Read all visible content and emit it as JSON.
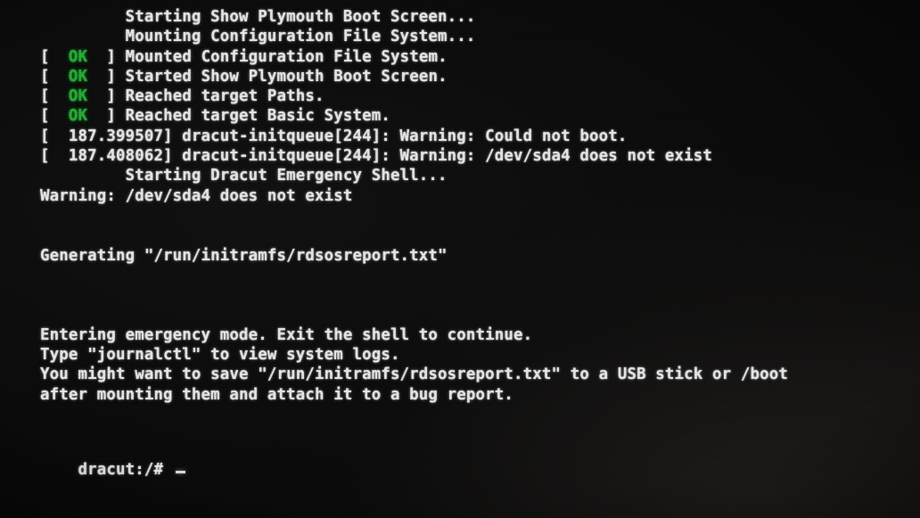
{
  "screen": {
    "kind": "linux-boot-console",
    "background_color": "#050505",
    "text_color": "#e9e9e6",
    "ok_color": "#25ad33"
  },
  "console": {
    "lines": [
      {
        "segments": [
          {
            "text": "         Starting Show Plymouth Boot Screen...",
            "style": "normal"
          }
        ]
      },
      {
        "segments": [
          {
            "text": "         Mounting Configuration File System...",
            "style": "normal"
          }
        ]
      },
      {
        "segments": [
          {
            "text": "[  ",
            "style": "normal"
          },
          {
            "text": "OK",
            "style": "ok"
          },
          {
            "text": "  ] Mounted Configuration File System.",
            "style": "normal"
          }
        ]
      },
      {
        "segments": [
          {
            "text": "[  ",
            "style": "normal"
          },
          {
            "text": "OK",
            "style": "ok"
          },
          {
            "text": "  ] Started Show Plymouth Boot Screen.",
            "style": "normal"
          }
        ]
      },
      {
        "segments": [
          {
            "text": "[  ",
            "style": "normal"
          },
          {
            "text": "OK",
            "style": "ok"
          },
          {
            "text": "  ] Reached target Paths.",
            "style": "normal"
          }
        ]
      },
      {
        "segments": [
          {
            "text": "[  ",
            "style": "normal"
          },
          {
            "text": "OK",
            "style": "ok"
          },
          {
            "text": "  ] Reached target Basic System.",
            "style": "normal"
          }
        ]
      },
      {
        "segments": [
          {
            "text": "[  187.399507] dracut-initqueue[244]: Warning: Could not boot.",
            "style": "normal"
          }
        ]
      },
      {
        "segments": [
          {
            "text": "[  187.408062] dracut-initqueue[244]: Warning: /dev/sda4 does not exist",
            "style": "normal"
          }
        ]
      },
      {
        "segments": [
          {
            "text": "         Starting Dracut Emergency Shell...",
            "style": "normal"
          }
        ]
      },
      {
        "segments": [
          {
            "text": "Warning: /dev/sda4 does not exist",
            "style": "normal"
          }
        ]
      },
      {
        "segments": [
          {
            "text": " ",
            "style": "blank"
          }
        ]
      },
      {
        "segments": [
          {
            "text": " ",
            "style": "blank"
          }
        ]
      },
      {
        "segments": [
          {
            "text": "Generating \"/run/initramfs/rdsosreport.txt\"",
            "style": "normal"
          }
        ]
      },
      {
        "segments": [
          {
            "text": " ",
            "style": "blank"
          }
        ]
      },
      {
        "segments": [
          {
            "text": " ",
            "style": "blank"
          }
        ]
      },
      {
        "segments": [
          {
            "text": " ",
            "style": "blank"
          }
        ]
      },
      {
        "segments": [
          {
            "text": "Entering emergency mode. Exit the shell to continue.",
            "style": "normal"
          }
        ]
      },
      {
        "segments": [
          {
            "text": "Type \"journalctl\" to view system logs.",
            "style": "normal"
          }
        ]
      },
      {
        "segments": [
          {
            "text": "You might want to save \"/run/initramfs/rdsosreport.txt\" to a USB stick or /boot",
            "style": "normal"
          }
        ]
      },
      {
        "segments": [
          {
            "text": "after mounting them and attach it to a bug report.",
            "style": "normal"
          }
        ]
      }
    ]
  },
  "prompt": {
    "text": "dracut:/#",
    "cursor": "_"
  }
}
